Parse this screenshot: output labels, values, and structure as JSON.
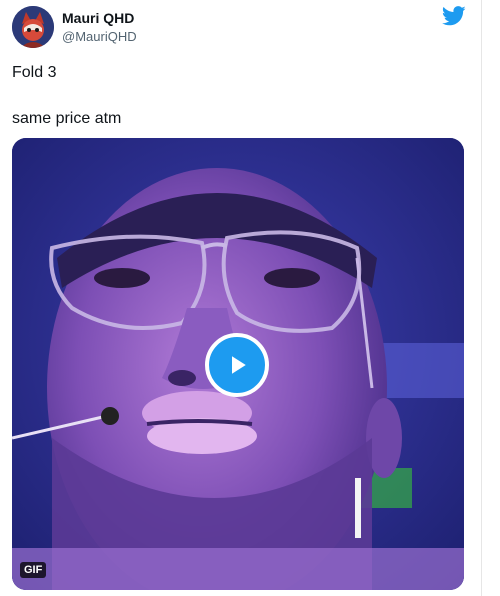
{
  "author": {
    "display_name": "Mauri QHD",
    "handle": "@MauriQHD",
    "avatar_icon": "avatar-image"
  },
  "brand": {
    "icon": "twitter-bird-icon",
    "color": "#1d9bf0"
  },
  "tweet": {
    "line1": "Fold 3",
    "line2": "same price atm"
  },
  "media": {
    "type": "gif",
    "badge": "GIF",
    "play_icon": "play-icon"
  }
}
